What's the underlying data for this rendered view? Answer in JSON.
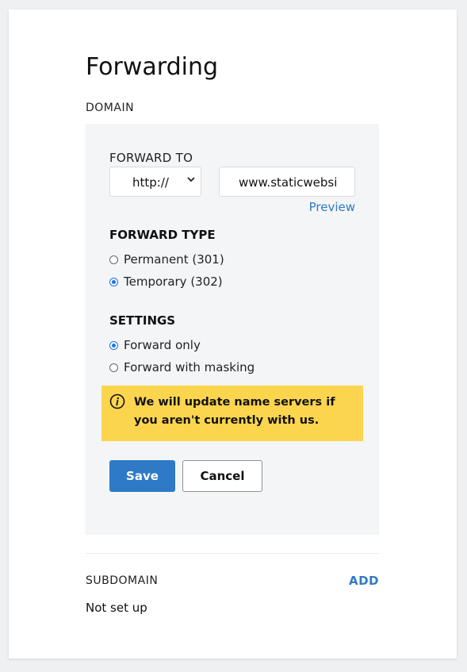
{
  "page": {
    "title": "Forwarding"
  },
  "domain": {
    "section_label": "DOMAIN",
    "forward_to_label": "FORWARD TO",
    "protocol_select": "http://",
    "url_value": "www.staticwebsi",
    "preview_label": "Preview",
    "forward_type": {
      "heading": "FORWARD TYPE",
      "options": [
        {
          "label": "Permanent (301)",
          "selected": false
        },
        {
          "label": "Temporary (302)",
          "selected": true
        }
      ]
    },
    "settings": {
      "heading": "SETTINGS",
      "options": [
        {
          "label": "Forward only",
          "selected": true
        },
        {
          "label": "Forward with masking",
          "selected": false
        }
      ]
    },
    "alert": {
      "icon": "info-icon",
      "text": "We will update name servers if you aren't currently with us.",
      "color": "#fcd54e"
    },
    "save_label": "Save",
    "cancel_label": "Cancel"
  },
  "subdomain": {
    "section_label": "SUBDOMAIN",
    "add_label": "ADD",
    "status": "Not set up"
  },
  "colors": {
    "accent": "#2f7ac6",
    "radio": "#1a73e8",
    "alert": "#fcd54e"
  }
}
